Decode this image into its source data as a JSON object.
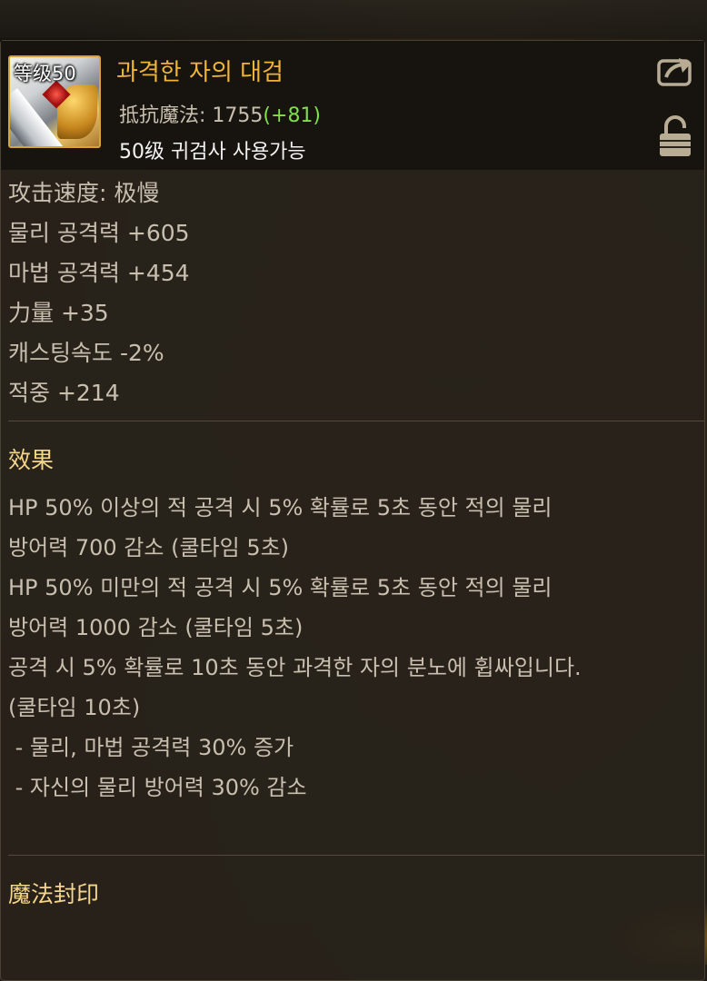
{
  "item": {
    "level_badge": "等级50",
    "name": "과격한 자의 대검",
    "resist_label": "抵抗魔法",
    "resist_sep": ": ",
    "resist_value": "1755",
    "resist_bonus": "(+81)",
    "requirement": "50级 귀검사 사용가능"
  },
  "header_icons": {
    "share": "share-export-icon",
    "lock": "unlocked-padlock-icon"
  },
  "stats": [
    "攻击速度:  极慢",
    "물리 공격력 +605",
    "마법 공격력 +454",
    "力量 +35",
    "캐스팅속도 -2%",
    "적중 +214"
  ],
  "effects": {
    "title": "效果",
    "lines": [
      "HP 50% 이상의 적 공격 시 5% 확률로 5초 동안 적의 물리",
      "방어력 700 감소 (쿨타임 5초)",
      "HP 50% 미만의 적 공격 시 5% 확률로 5초 동안 적의 물리",
      "방어력 1000 감소 (쿨타임 5초)",
      "공격 시 5% 확률로 10초 동안 과격한 자의 분노에 휩싸입니다.",
      "(쿨타임 10초)",
      " - 물리, 마법 공격력 30% 증가",
      " - 자신의 물리 방어력 30% 감소"
    ]
  },
  "magic_seal": {
    "title": "魔法封印"
  },
  "colors": {
    "item_name": "#f0b537",
    "bonus_green": "#7fe04b",
    "section_title": "#f4d58a",
    "body_text": "#c9bfae"
  }
}
